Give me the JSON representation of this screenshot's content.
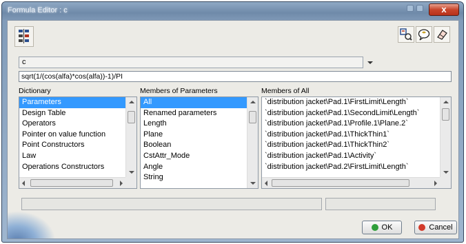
{
  "window": {
    "title": "Formula Editor : c",
    "close_symbol": "x"
  },
  "toolbar": {
    "left_icon": "formula-tree-icon",
    "right_icons": [
      "formula-search-icon",
      "comment-icon",
      "eraser-icon"
    ]
  },
  "parameter_combo": {
    "value": "c"
  },
  "formula": {
    "value": "sqrt(1/(cos(alfa)*cos(alfa))-1)/PI"
  },
  "dictionary": {
    "header": "Dictionary",
    "items": [
      "Parameters",
      "Design Table",
      "Operators",
      "Pointer on value function",
      "Point Constructors",
      "Law",
      "Operations Constructors"
    ],
    "selected": "Parameters"
  },
  "members_of_parameters": {
    "header": "Members of Parameters",
    "items": [
      "All",
      "Renamed parameters",
      "Length",
      "Plane",
      "Boolean",
      "CstAttr_Mode",
      "Angle",
      "String"
    ],
    "selected": "All"
  },
  "members_of_all": {
    "header": "Members of All",
    "items": [
      "`distribution jacket\\Pad.1\\FirstLimit\\Length`",
      "`distribution jacket\\Pad.1\\SecondLimit\\Length`",
      "`distribution jacket\\Pad.1\\Profile.1\\Plane.2`",
      "`distribution jacket\\Pad.1\\ThickThin1`",
      "`distribution jacket\\Pad.1\\ThickThin2`",
      "`distribution jacket\\Pad.1\\Activity`",
      "`distribution jacket\\Pad.2\\FirstLimit\\Length`"
    ]
  },
  "buttons": {
    "ok_label": "OK",
    "cancel_label": "Cancel"
  },
  "colors": {
    "selection": "#3399ff",
    "ok_dot": "#2f9e3a",
    "cancel_dot": "#d23a2a",
    "close_button": "#c8452b"
  }
}
